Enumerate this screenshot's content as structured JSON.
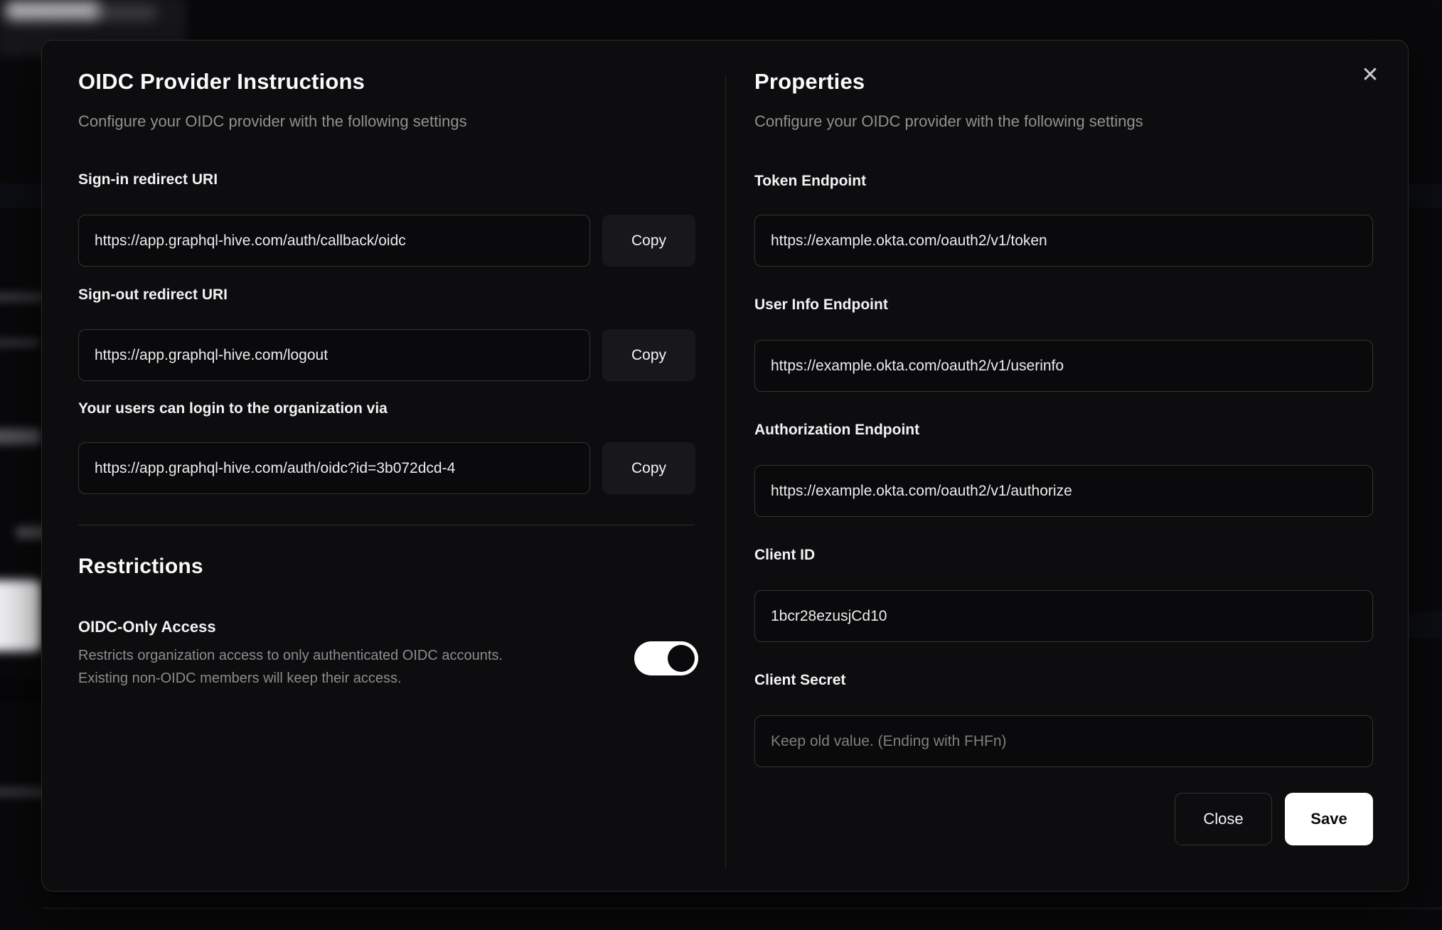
{
  "modal": {
    "close_icon": "✕",
    "left": {
      "title": "OIDC Provider Instructions",
      "subtitle": "Configure your OIDC provider with the following settings",
      "fields": [
        {
          "label": "Sign-in redirect URI",
          "value": "https://app.graphql-hive.com/auth/callback/oidc",
          "copy_label": "Copy"
        },
        {
          "label": "Sign-out redirect URI",
          "value": "https://app.graphql-hive.com/logout",
          "copy_label": "Copy"
        },
        {
          "label": "Your users can login to the organization via",
          "value": "https://app.graphql-hive.com/auth/oidc?id=3b072dcd-4",
          "copy_label": "Copy"
        }
      ],
      "restrictions": {
        "title": "Restrictions",
        "toggle_label": "OIDC-Only Access",
        "description_lines": [
          "Restricts organization access to only authenticated OIDC accounts.",
          "Existing non-OIDC members will keep their access."
        ],
        "toggle_on": true
      }
    },
    "right": {
      "title": "Properties",
      "subtitle": "Configure your OIDC provider with the following settings",
      "fields": [
        {
          "label": "Token Endpoint",
          "value": "https://example.okta.com/oauth2/v1/token",
          "placeholder": ""
        },
        {
          "label": "User Info Endpoint",
          "value": "https://example.okta.com/oauth2/v1/userinfo",
          "placeholder": ""
        },
        {
          "label": "Authorization Endpoint",
          "value": "https://example.okta.com/oauth2/v1/authorize",
          "placeholder": ""
        },
        {
          "label": "Client ID",
          "value": "1bcr28ezusjCd10",
          "placeholder": ""
        },
        {
          "label": "Client Secret",
          "value": "",
          "placeholder": "Keep old value. (Ending with FHFn)"
        }
      ],
      "buttons": {
        "close_label": "Close",
        "save_label": "Save"
      }
    },
    "colors": {
      "save_button_bg": "#ffffff",
      "toggle_on_track": "#ffffff",
      "modal_bg": "#0d0d0f",
      "page_bg": "#09090b",
      "input_border": "#37332c"
    }
  }
}
